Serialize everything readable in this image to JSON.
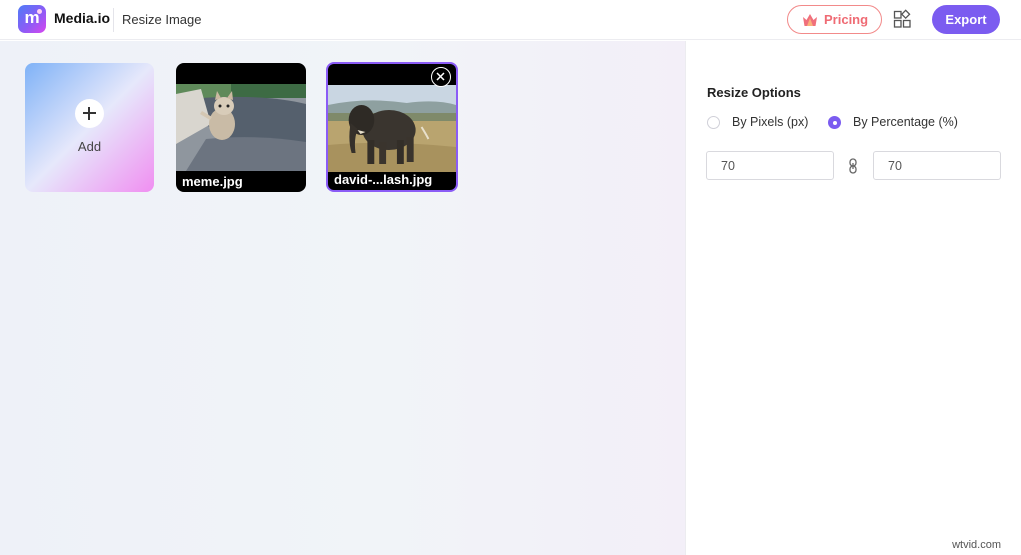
{
  "app": {
    "brand_name": "Media.io",
    "logo_letter": "m",
    "page_title": "Resize Image",
    "accent_color": "#7b5cf0"
  },
  "header": {
    "pricing_label": "Pricing",
    "pricing_icon": "crown-icon",
    "apps_icon": "apps-grid-icon",
    "export_label": "Export"
  },
  "workspace": {
    "add_card": {
      "icon": "plus-icon",
      "label": "Add"
    },
    "files": [
      {
        "name": "meme.jpg",
        "selected": false
      },
      {
        "name": "david-...lash.jpg",
        "selected": true,
        "remove_icon": "close-circle-icon"
      }
    ]
  },
  "resize_options": {
    "title": "Resize Options",
    "modes": [
      {
        "label": "By Pixels (px)",
        "selected": false
      },
      {
        "label": "By Percentage (%)",
        "selected": true
      }
    ],
    "width_value": "70",
    "height_value": "70",
    "link_icon": "link-icon"
  },
  "watermark": "wtvid.com"
}
